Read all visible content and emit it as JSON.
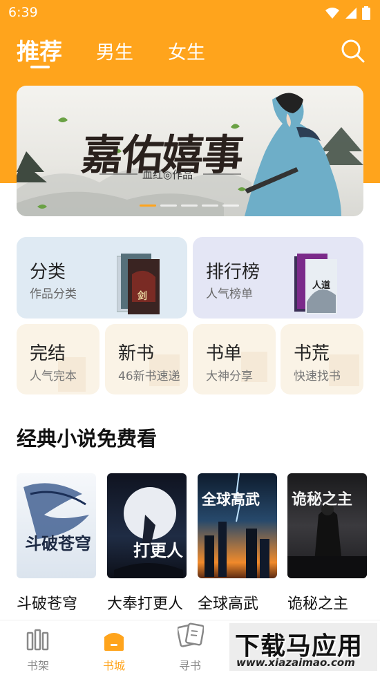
{
  "status_bar": {
    "time": "6:39"
  },
  "tabs": [
    {
      "label": "推荐"
    },
    {
      "label": "男生"
    },
    {
      "label": "女生"
    }
  ],
  "banner": {
    "title": "嘉佑嬉事",
    "author": "血红◎作品",
    "slides": 5,
    "active_slide": 1
  },
  "categories": [
    {
      "title": "分类",
      "subtitle": "作品分类"
    },
    {
      "title": "排行榜",
      "subtitle": "人气榜单"
    }
  ],
  "shortcuts": [
    {
      "title": "完结",
      "subtitle": "人气完本"
    },
    {
      "title": "新书",
      "subtitle": "46新书速递"
    },
    {
      "title": "书单",
      "subtitle": "大神分享"
    },
    {
      "title": "书荒",
      "subtitle": "快速找书"
    }
  ],
  "section": {
    "title": "经典小说免费看"
  },
  "books": [
    {
      "title": "斗破苍穹",
      "cover_text": "斗破苍穹"
    },
    {
      "title": "大奉打更人",
      "cover_text": "打更人"
    },
    {
      "title": "全球高武",
      "cover_text": "全球高武"
    },
    {
      "title": "诡秘之主",
      "cover_text": "诡秘之主"
    }
  ],
  "bottom_nav": [
    {
      "label": "书架",
      "icon": "bookshelf-icon"
    },
    {
      "label": "书城",
      "icon": "bookstore-icon",
      "active": true
    },
    {
      "label": "寻书",
      "icon": "find-book-icon"
    }
  ],
  "watermark": {
    "main": "下载马应用",
    "url": "www.xiazaimao.com"
  },
  "colors": {
    "accent": "#ffa41c",
    "card_blue": "#dfeaf3",
    "card_lavender": "#e4e6f5",
    "card_cream": "#faf3e6"
  }
}
